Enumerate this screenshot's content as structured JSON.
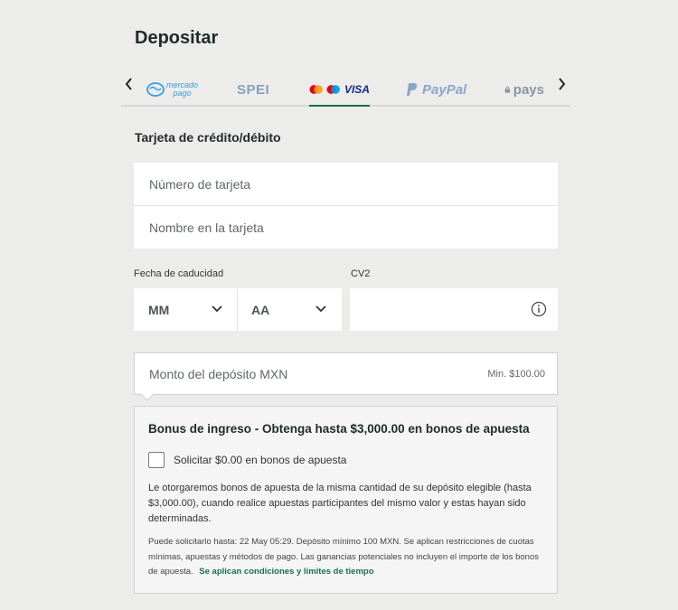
{
  "page": {
    "title": "Depositar"
  },
  "tabs": {
    "mercadopago_top": "mercado",
    "mercadopago_bottom": "pago",
    "spei": "SPEI",
    "card": "VISA",
    "paypal": "PayPal",
    "pays": "pays"
  },
  "card_form": {
    "section_title": "Tarjeta de crédito/débito",
    "card_number_placeholder": "Número de tarjeta",
    "card_name_placeholder": "Nombre en la tarjeta",
    "expiry_label": "Fecha de caducidad",
    "month_value": "MM",
    "year_value": "AA",
    "cvv_label": "CV2"
  },
  "deposit": {
    "amount_placeholder": "Monto del depósito MXN",
    "min_text": "Min. $100.00"
  },
  "bonus": {
    "title": "Bonus de ingreso - Obtenga hasta $3,000.00 en bonos de apuesta",
    "checkbox_label": "Solicitar $0.00 en bonos de apuesta",
    "description": "Le otorgaremos bonos de apuesta de la misma cantidad de su depósito elegible (hasta $3,000.00), cuando realice apuestas participantes del mismo valor y estas hayan sido determinadas.",
    "fine_print": "Puede solicitarlo hasta: 22 May 05:29. Depósito mínimo 100 MXN. Se aplican restricciones de cuotas mínimas, apuestas y métodos de pago. Las ganancias potenciales no incluyen el importe de los bonos de apuesta.",
    "terms_link": "Se aplican condiciones y límites de tiempo"
  },
  "colors": {
    "accent": "#1b6e4e",
    "background": "#ececeb",
    "mastercard_red": "#eb001b",
    "mastercard_orange": "#f79e1b",
    "maestro_blue": "#0099df"
  }
}
